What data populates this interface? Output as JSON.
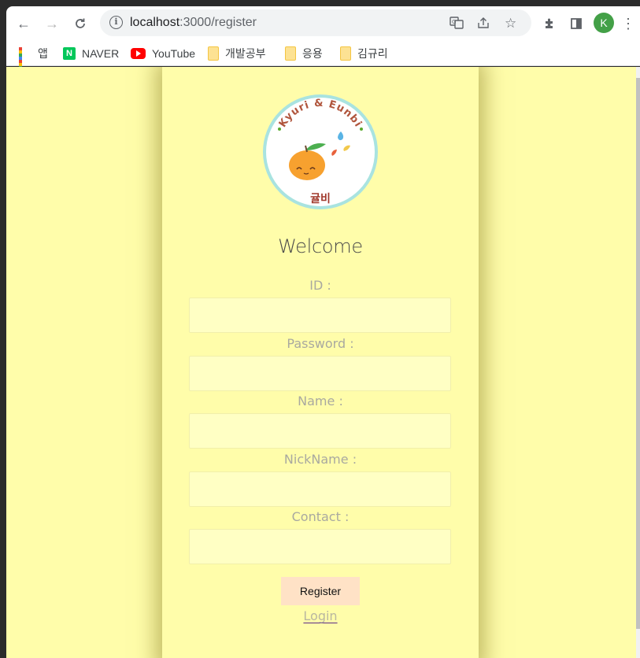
{
  "browser": {
    "url_host": "localhost",
    "url_path": ":3000/register",
    "profile_initial": "K",
    "profile_color": "#43a047",
    "icons": [
      "back-icon",
      "forward-icon",
      "reload-icon",
      "info-icon",
      "translate-icon",
      "share-icon",
      "star-icon",
      "extensions-icon",
      "side-panel-icon",
      "menu-icon"
    ]
  },
  "bookmarks": [
    {
      "label": "앱",
      "icon": "apps-icon"
    },
    {
      "label": "NAVER",
      "icon": "naver-icon"
    },
    {
      "label": "YouTube",
      "icon": "youtube-icon"
    },
    {
      "label": "개발공부",
      "icon": "folder-icon"
    },
    {
      "label": "응용",
      "icon": "folder-icon"
    },
    {
      "label": "김규리",
      "icon": "folder-icon"
    }
  ],
  "logo": {
    "arc_text": "Kyuri & Eunbi",
    "bottom_text": "귤비"
  },
  "form": {
    "title": "Welcome",
    "fields": [
      {
        "label": "ID :",
        "value": ""
      },
      {
        "label": "Password :",
        "value": ""
      },
      {
        "label": "Name :",
        "value": ""
      },
      {
        "label": "NickName :",
        "value": ""
      },
      {
        "label": "Contact :",
        "value": ""
      }
    ],
    "submit_label": "Register",
    "login_label": "Login"
  },
  "colors": {
    "page_background": "#fffdaa",
    "input_background": "#ffffc4",
    "register_button": "#ffe2c6"
  }
}
